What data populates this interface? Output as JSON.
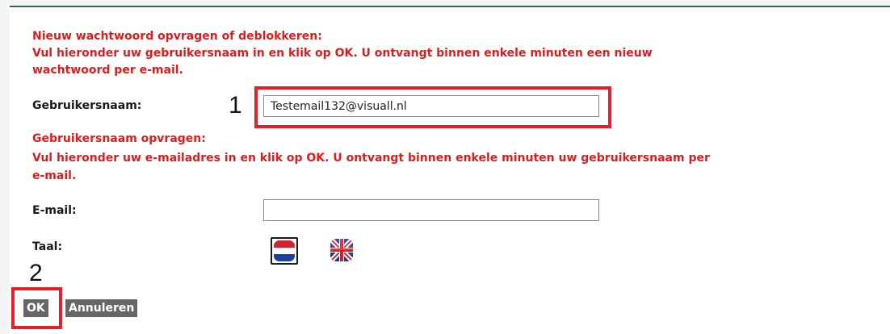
{
  "password_section": {
    "heading": "Nieuw wachtwoord opvragen of deblokkeren:",
    "line1": "Vul hieronder uw gebruikersnaam in en klik op OK. U ontvangt binnen enkele minuten een nieuw",
    "line2": "wachtwoord per e-mail."
  },
  "username_field": {
    "label": "Gebruikersnaam:",
    "value": "Testemail132@visuall.nl",
    "step_marker": "1"
  },
  "username_section": {
    "heading": "Gebruikersnaam opvragen:",
    "line1": "Vul hieronder uw e-mailadres in en klik op OK. U ontvangt binnen enkele minuten uw gebruikersnaam per",
    "line2": "e-mail."
  },
  "email_field": {
    "label": "E-mail:",
    "value": ""
  },
  "language": {
    "label": "Taal:",
    "options": [
      {
        "icon": "netherlands-flag-icon",
        "selected": true
      },
      {
        "icon": "united-kingdom-flag-icon",
        "selected": false
      }
    ]
  },
  "actions": {
    "step_marker": "2",
    "ok_label": "OK",
    "cancel_label": "Annuleren"
  },
  "colors": {
    "accent_red": "#dd1c1c",
    "highlight_red": "#e5202a",
    "top_border_green": "#2f6b3f",
    "button_gray": "#666666"
  }
}
